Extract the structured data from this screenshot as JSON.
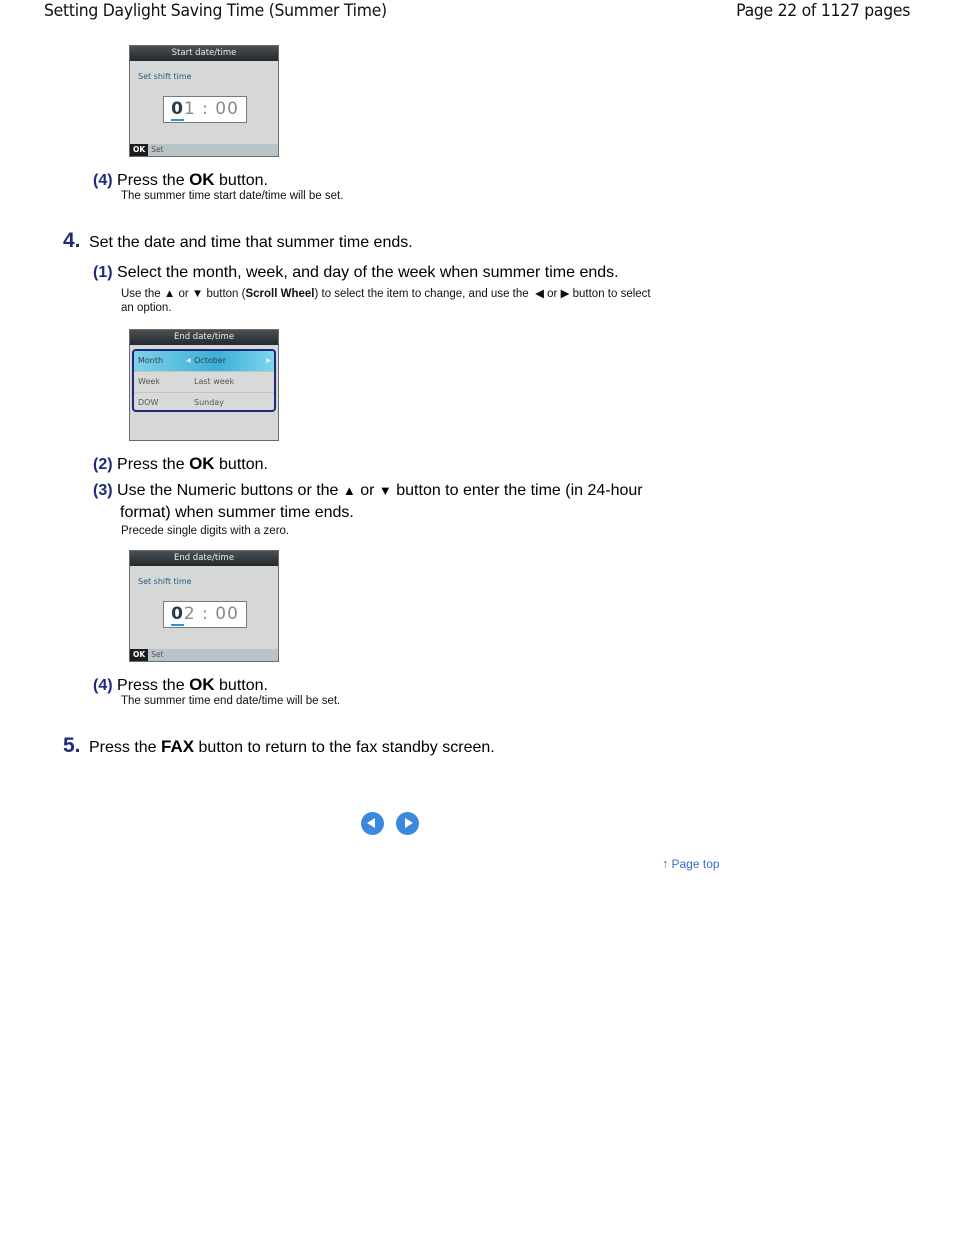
{
  "header": {
    "title": "Setting Daylight Saving Time (Summer Time)",
    "page": "Page 22 of 1127 pages"
  },
  "screen_start": {
    "title": "Start date/time",
    "subtitle": "Set shift time",
    "hour_cursor": "0",
    "hour_rest": "1",
    "sep": ":",
    "minutes": "00",
    "ok_key": "OK",
    "ok_label": "Set"
  },
  "substep_4a": {
    "num": "(4)",
    "pre": "Press the",
    "key": "OK",
    "post": "button.",
    "note": "The summer time start date/time will be set."
  },
  "step4": {
    "num": "4.",
    "text": "Set the date and time that summer time ends."
  },
  "substep_1": {
    "num": "(1)",
    "text": "Select the month, week, and day of the week when summer time ends.",
    "note_pre": "Use the",
    "up": "▲",
    "or1": "or",
    "down": "▼",
    "btn1": "button (",
    "scroll": "Scroll Wheel",
    "mid": ") to select the item to change, and use the",
    "left": "◀",
    "or2": "or",
    "right": "▶",
    "tail": "button to select",
    "tail2": "an option."
  },
  "screen_end_list": {
    "title": "End date/time",
    "rows": [
      {
        "key": "Month",
        "value": "October",
        "selected": true
      },
      {
        "key": "Week",
        "value": "Last week",
        "selected": false
      },
      {
        "key": "DOW",
        "value": "Sunday",
        "selected": false
      }
    ]
  },
  "substep_2": {
    "num": "(2)",
    "pre": "Press the",
    "key": "OK",
    "post": "button."
  },
  "substep_3": {
    "num": "(3)",
    "pre": "Use the Numeric buttons or the",
    "up": "▲",
    "or": "or",
    "down": "▼",
    "post": "button to enter the time (in 24-hour",
    "cont": "format) when summer time ends.",
    "note": "Precede single digits with a zero."
  },
  "screen_end": {
    "title": "End date/time",
    "subtitle": "Set shift time",
    "hour_cursor": "0",
    "hour_rest": "2",
    "sep": ":",
    "minutes": "00",
    "ok_key": "OK",
    "ok_label": "Set"
  },
  "substep_4b": {
    "num": "(4)",
    "pre": "Press the",
    "key": "OK",
    "post": "button.",
    "note": "The summer time end date/time will be set."
  },
  "step5": {
    "num": "5.",
    "pre": "Press the",
    "key": "FAX",
    "post": "button to return to the fax standby screen."
  },
  "nav": {
    "prev_icon": "previous-page-icon",
    "next_icon": "next-page-icon",
    "page_top": "Page top",
    "page_top_icon": "up-arrow-icon",
    "page_top_glyph": "↑"
  }
}
